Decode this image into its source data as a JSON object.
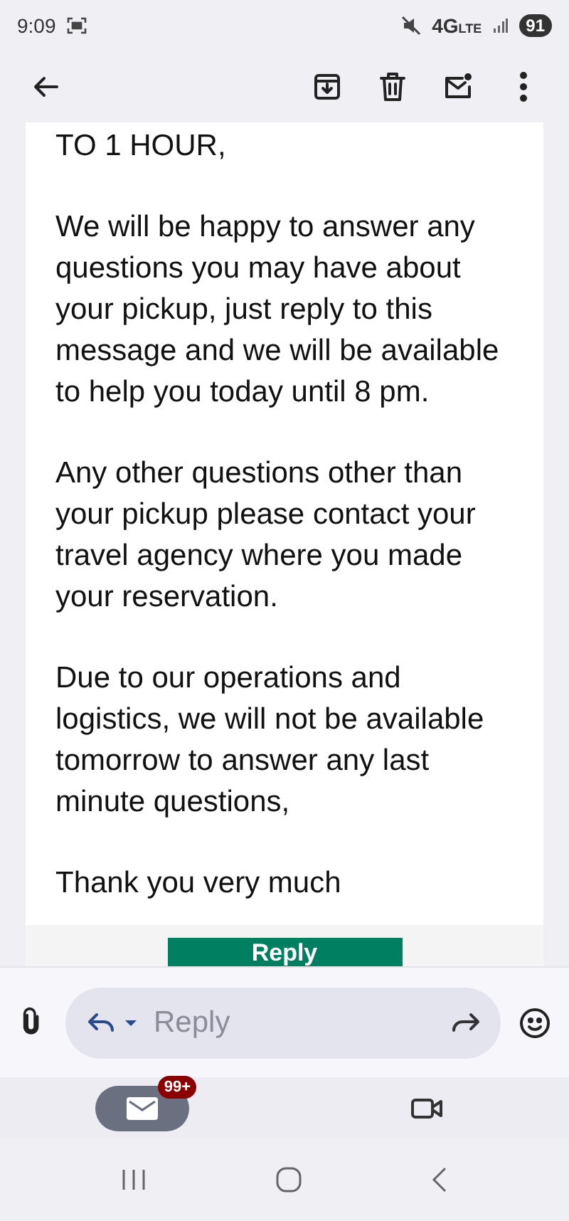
{
  "status_bar": {
    "time": "9:09",
    "network": "4G",
    "network_sub": "LTE",
    "battery": "91"
  },
  "message": {
    "paragraphs": [
      [
        "TO 1 HOUR,"
      ],
      [
        "We will be happy to answer any",
        "questions you may have about",
        "your pickup, just reply to this",
        "message and we will be available",
        "to help you today until 8 pm."
      ],
      [
        "Any other questions other than",
        "your pickup please contact your",
        "travel agency where you made",
        "your reservation."
      ],
      [
        "Due to our operations and",
        "logistics, we will not be available",
        "tomorrow to answer any last",
        "minute questions,"
      ],
      [
        "Thank you very much"
      ]
    ],
    "action_button": "Reply"
  },
  "compose": {
    "placeholder": "Reply"
  },
  "bottom_nav": [
    {
      "kind": "mail",
      "badge": "99+",
      "selected": true
    },
    {
      "kind": "video",
      "selected": false
    }
  ]
}
